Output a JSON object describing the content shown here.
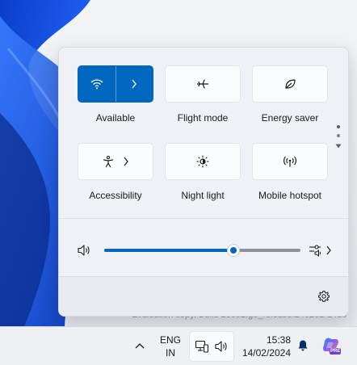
{
  "watermark": "Evaluation copy. Build 26052.ge_release.240202-1419",
  "quick_settings": {
    "tiles": [
      {
        "id": "wifi",
        "label": "Available",
        "icon": "wifi-icon",
        "active": true,
        "has_arrow": true
      },
      {
        "id": "flight",
        "label": "Flight mode",
        "icon": "airplane-icon",
        "active": false,
        "has_arrow": false
      },
      {
        "id": "energy",
        "label": "Energy saver",
        "icon": "leaf-icon",
        "active": false,
        "has_arrow": false
      },
      {
        "id": "accessibility",
        "label": "Accessibility",
        "icon": "accessibility-icon",
        "active": false,
        "has_arrow": true
      },
      {
        "id": "night",
        "label": "Night light",
        "icon": "night-light-icon",
        "active": false,
        "has_arrow": false
      },
      {
        "id": "hotspot",
        "label": "Mobile hotspot",
        "icon": "hotspot-icon",
        "active": false,
        "has_arrow": false
      }
    ],
    "volume": {
      "level_percent": 66,
      "icon": "speaker-icon",
      "output_icon": "audio-output-icon"
    },
    "settings_icon": "gear-icon",
    "pager": {
      "pages": 2,
      "current": 1
    }
  },
  "taskbar": {
    "language": {
      "line1": "ENG",
      "line2": "IN"
    },
    "time": "15:38",
    "date": "14/02/2024",
    "icons": [
      "chevron-up-icon",
      "network-icon",
      "speaker-icon",
      "bell-icon",
      "copilot-icon"
    ],
    "copilot_badge": "PRE"
  },
  "colors": {
    "accent": "#0067c0",
    "flyout_bg": "#eef1f5",
    "taskbar_bg": "#eef0f3"
  }
}
